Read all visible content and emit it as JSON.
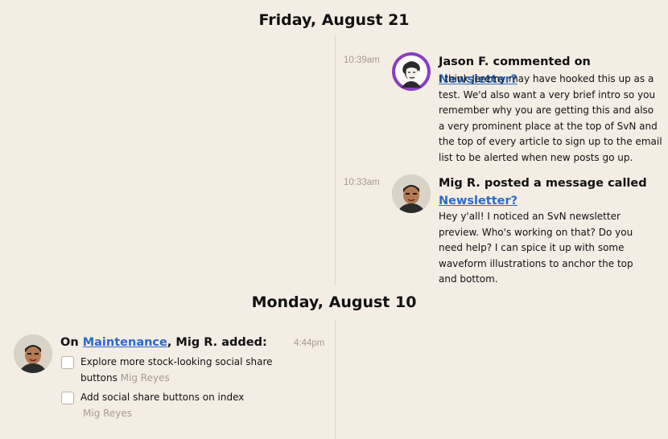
{
  "days": [
    {
      "date": "Friday, August 21",
      "events": [
        {
          "time": "10:39am",
          "actor_action": "Jason F. commented on",
          "link": "Newsletter?",
          "body": "I think Jeremy may have hooked this up as a test. We'd also want a very brief intro so you remember why you are getting this and also a very prominent place at the top of SvN and the top of every article to sign up to the email list to be alerted when new posts go up."
        },
        {
          "time": "10:33am",
          "actor_action": "Mig R. posted a message called",
          "link": "Newsletter?",
          "body": "Hey y'all! I noticed an SvN newsletter preview. Who's working on that? Do you need help? I can spice it up with some waveform illustrations to anchor the top and bottom."
        }
      ]
    },
    {
      "date": "Monday, August 10",
      "events": [
        {
          "time": "4:44pm",
          "prefix": "On",
          "link": "Maintenance",
          "suffix": ", Mig R. added:",
          "todos": [
            {
              "text": "Explore more stock-looking social share buttons",
              "assignee": "Mig Reyes"
            },
            {
              "text": "Add social share buttons on index",
              "assignee": "Mig Reyes"
            }
          ]
        }
      ]
    }
  ],
  "colors": {
    "background": "#f3ede4",
    "link": "#2a6ac9",
    "muted": "#a59c8f",
    "avatar_ring_jason": "#8a3fbf"
  },
  "icons": {
    "avatar_jason": "avatar-jason-icon",
    "avatar_mig": "avatar-mig-icon",
    "checkbox": "checkbox-icon"
  }
}
